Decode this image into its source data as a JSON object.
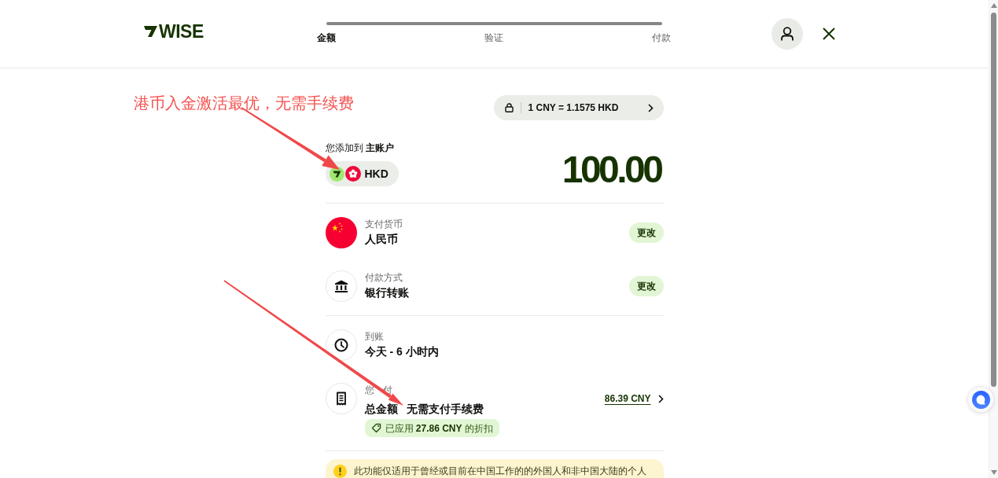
{
  "header": {
    "logo": "WISE",
    "steps": [
      {
        "label": "金额",
        "selected": true
      },
      {
        "label": "验证",
        "selected": false
      },
      {
        "label": "付款",
        "selected": false
      }
    ]
  },
  "annotation": {
    "text": "港币入金激活最优，无需手续费"
  },
  "rate": {
    "text": "1 CNY = 1.1575 HKD"
  },
  "destination": {
    "label": "您添加到 **主账户**",
    "currency": "HKD",
    "amount": "100.00"
  },
  "sections": [
    {
      "rows": [
        {
          "kind": "flag",
          "label": "支付货币",
          "value": "人民币",
          "action": "更改"
        },
        {
          "kind": "bank",
          "label": "付款方式",
          "value": "银行转账",
          "action": "更改"
        }
      ]
    },
    {
      "rows": [
        {
          "kind": "clock",
          "label": "到账",
          "value": "今天 - 6 小时内"
        },
        {
          "kind": "receipt",
          "label": "您 付",
          "value": "总金额 无需支付手续费",
          "discount": "已应用 **27.86 CNY** 的折扣",
          "amount": "86.39 CNY"
        }
      ]
    }
  ],
  "notice": {
    "text": "此功能仅适用于曾经或目前在中国工作的的外国人和非中国大陆的个人"
  }
}
